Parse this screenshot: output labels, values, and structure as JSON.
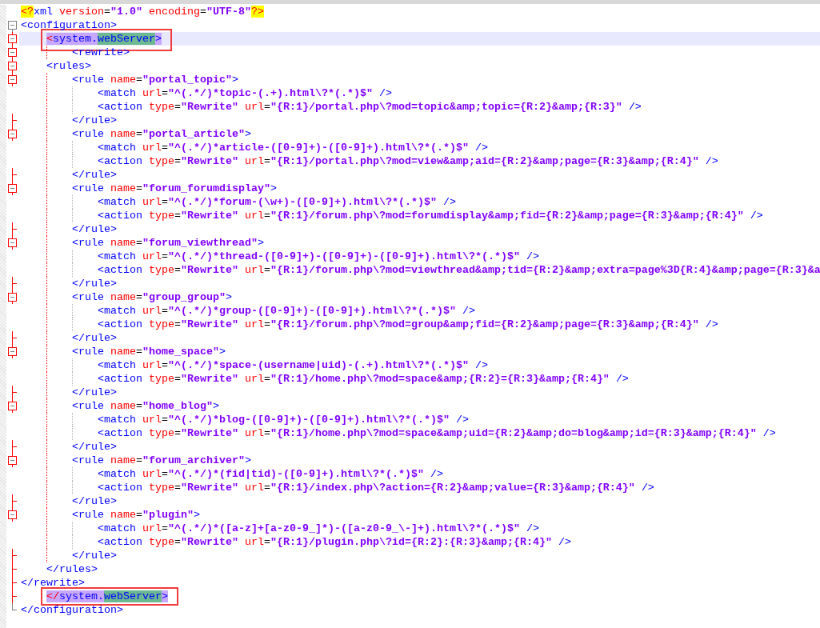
{
  "editor": {
    "lines": [
      {
        "text": "<?xml version=\"1.0\" encoding=\"UTF-8\"?>",
        "kind": "plain",
        "current": false,
        "match_highlight": false
      },
      {
        "text": "<configuration>",
        "kind": "fold",
        "current": false,
        "match_highlight": false
      },
      {
        "text": "    <system.webServer>",
        "kind": "fold",
        "current": true,
        "match_highlight": true
      },
      {
        "text": "        <rewrite>",
        "kind": "fold",
        "current": false,
        "match_highlight": false
      },
      {
        "text": "    <rules>",
        "kind": "fold",
        "current": false,
        "match_highlight": false
      },
      {
        "text": "        <rule name=\"portal_topic\">",
        "kind": "fold",
        "current": false,
        "match_highlight": false
      },
      {
        "text": "            <match url=\"^(.*/)*topic-(.+).html\\?*(.*)$\" />",
        "kind": "plain",
        "current": false,
        "match_highlight": false
      },
      {
        "text": "            <action type=\"Rewrite\" url=\"{R:1}/portal.php\\?mod=topic&amp;topic={R:2}&amp;{R:3}\" />",
        "kind": "plain",
        "current": false,
        "match_highlight": false
      },
      {
        "text": "        </rule>",
        "kind": "tick",
        "current": false,
        "match_highlight": false
      },
      {
        "text": "        <rule name=\"portal_article\">",
        "kind": "fold",
        "current": false,
        "match_highlight": false
      },
      {
        "text": "            <match url=\"^(.*/)*article-([0-9]+)-([0-9]+).html\\?*(.*)$\" />",
        "kind": "plain",
        "current": false,
        "match_highlight": false
      },
      {
        "text": "            <action type=\"Rewrite\" url=\"{R:1}/portal.php\\?mod=view&amp;aid={R:2}&amp;page={R:3}&amp;{R:4}\" />",
        "kind": "plain",
        "current": false,
        "match_highlight": false
      },
      {
        "text": "        </rule>",
        "kind": "tick",
        "current": false,
        "match_highlight": false
      },
      {
        "text": "        <rule name=\"forum_forumdisplay\">",
        "kind": "fold",
        "current": false,
        "match_highlight": false
      },
      {
        "text": "            <match url=\"^(.*/)*forum-(\\w+)-([0-9]+).html\\?*(.*)$\" />",
        "kind": "plain",
        "current": false,
        "match_highlight": false
      },
      {
        "text": "            <action type=\"Rewrite\" url=\"{R:1}/forum.php\\?mod=forumdisplay&amp;fid={R:2}&amp;page={R:3}&amp;{R:4}\" />",
        "kind": "plain",
        "current": false,
        "match_highlight": false
      },
      {
        "text": "        </rule>",
        "kind": "tick",
        "current": false,
        "match_highlight": false
      },
      {
        "text": "        <rule name=\"forum_viewthread\">",
        "kind": "fold",
        "current": false,
        "match_highlight": false
      },
      {
        "text": "            <match url=\"^(.*/)*thread-([0-9]+)-([0-9]+)-([0-9]+).html\\?*(.*)$\" />",
        "kind": "plain",
        "current": false,
        "match_highlight": false
      },
      {
        "text": "            <action type=\"Rewrite\" url=\"{R:1}/forum.php\\?mod=viewthread&amp;tid={R:2}&amp;extra=page%3D{R:4}&amp;page={R:3}&a",
        "kind": "plain",
        "current": false,
        "match_highlight": false
      },
      {
        "text": "        </rule>",
        "kind": "tick",
        "current": false,
        "match_highlight": false
      },
      {
        "text": "        <rule name=\"group_group\">",
        "kind": "fold",
        "current": false,
        "match_highlight": false
      },
      {
        "text": "            <match url=\"^(.*/)*group-([0-9]+)-([0-9]+).html\\?*(.*)$\" />",
        "kind": "plain",
        "current": false,
        "match_highlight": false
      },
      {
        "text": "            <action type=\"Rewrite\" url=\"{R:1}/forum.php\\?mod=group&amp;fid={R:2}&amp;page={R:3}&amp;{R:4}\" />",
        "kind": "plain",
        "current": false,
        "match_highlight": false
      },
      {
        "text": "        </rule>",
        "kind": "tick",
        "current": false,
        "match_highlight": false
      },
      {
        "text": "        <rule name=\"home_space\">",
        "kind": "fold",
        "current": false,
        "match_highlight": false
      },
      {
        "text": "            <match url=\"^(.*/)*space-(username|uid)-(.+).html\\?*(.*)$\" />",
        "kind": "plain",
        "current": false,
        "match_highlight": false
      },
      {
        "text": "            <action type=\"Rewrite\" url=\"{R:1}/home.php\\?mod=space&amp;{R:2}={R:3}&amp;{R:4}\" />",
        "kind": "plain",
        "current": false,
        "match_highlight": false
      },
      {
        "text": "        </rule>",
        "kind": "tick",
        "current": false,
        "match_highlight": false
      },
      {
        "text": "        <rule name=\"home_blog\">",
        "kind": "fold",
        "current": false,
        "match_highlight": false
      },
      {
        "text": "            <match url=\"^(.*/)*blog-([0-9]+)-([0-9]+).html\\?*(.*)$\" />",
        "kind": "plain",
        "current": false,
        "match_highlight": false
      },
      {
        "text": "            <action type=\"Rewrite\" url=\"{R:1}/home.php\\?mod=space&amp;uid={R:2}&amp;do=blog&amp;id={R:3}&amp;{R:4}\" />",
        "kind": "plain",
        "current": false,
        "match_highlight": false
      },
      {
        "text": "        </rule>",
        "kind": "tick",
        "current": false,
        "match_highlight": false
      },
      {
        "text": "        <rule name=\"forum_archiver\">",
        "kind": "fold",
        "current": false,
        "match_highlight": false
      },
      {
        "text": "            <match url=\"^(.*/)*(fid|tid)-([0-9]+).html\\?*(.*)$\" />",
        "kind": "plain",
        "current": false,
        "match_highlight": false
      },
      {
        "text": "            <action type=\"Rewrite\" url=\"{R:1}/index.php\\?action={R:2}&amp;value={R:3}&amp;{R:4}\" />",
        "kind": "plain",
        "current": false,
        "match_highlight": false
      },
      {
        "text": "        </rule>",
        "kind": "tick",
        "current": false,
        "match_highlight": false
      },
      {
        "text": "        <rule name=\"plugin\">",
        "kind": "fold",
        "current": false,
        "match_highlight": false
      },
      {
        "text": "            <match url=\"^(.*/)*([a-z]+[a-z0-9_]*)-([a-z0-9_\\-]+).html\\?*(.*)$\" />",
        "kind": "plain",
        "current": false,
        "match_highlight": false
      },
      {
        "text": "            <action type=\"Rewrite\" url=\"{R:1}/plugin.php\\?id={R:2}:{R:3}&amp;{R:4}\" />",
        "kind": "plain",
        "current": false,
        "match_highlight": false
      },
      {
        "text": "        </rule>",
        "kind": "tick",
        "current": false,
        "match_highlight": false
      },
      {
        "text": "    </rules>",
        "kind": "tick",
        "current": false,
        "match_highlight": false
      },
      {
        "text": "</rewrite>",
        "kind": "tick",
        "current": false,
        "match_highlight": false
      },
      {
        "text": "    </system.webServer>",
        "kind": "tick",
        "current": false,
        "match_highlight": true
      },
      {
        "text": "</configuration>",
        "kind": "end",
        "current": false,
        "match_highlight": false
      }
    ]
  }
}
